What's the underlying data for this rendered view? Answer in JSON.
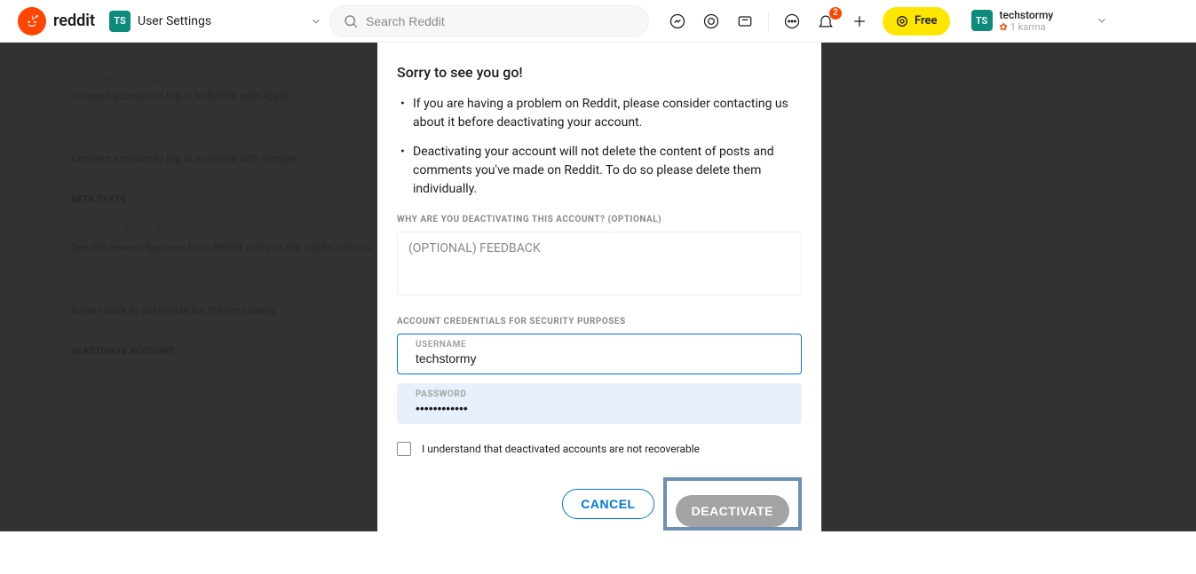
{
  "header": {
    "brand": "reddit",
    "avatar_initials": "TS",
    "community_label": "User Settings",
    "search_placeholder": "Search Reddit",
    "notification_count": "2",
    "free_label": "Free",
    "username": "techstormy",
    "karma_line": "1 karma"
  },
  "settings": {
    "apple_title": "Connect to Apple",
    "apple_desc": "Connect account to log in to Reddit with Apple",
    "google_title": "Connect to Google",
    "google_desc": "Connect account to log in to Reddit with Google",
    "beta_section": "BETA TESTS",
    "beta_opt_title": "Opt into beta tests",
    "beta_opt_desc": "See the newest features from Reddit and join the r/beta commu",
    "redesign_title": "Opt out of the redesign",
    "redesign_desc": "Revert back to old Reddit for the time being",
    "deactivate_section": "DEACTIVATE ACCOUNT"
  },
  "modal": {
    "title": "Sorry to see you go!",
    "bullet1": "If you are having a problem on Reddit, please consider contacting us about it before deactivating your account.",
    "bullet2": "Deactivating your account will not delete the content of posts and comments you've made on Reddit. To do so please delete them individually.",
    "why_label": "WHY ARE YOU DEACTIVATING THIS ACCOUNT? (OPTIONAL)",
    "feedback_placeholder": "(OPTIONAL) FEEDBACK",
    "credentials_label": "ACCOUNT CREDENTIALS FOR SECURITY PURPOSES",
    "username_label": "USERNAME",
    "username_value": "techstormy",
    "password_label": "PASSWORD",
    "password_value": "••••••••••••",
    "checkbox_label": "I understand that deactivated accounts are not recoverable",
    "cancel": "CANCEL",
    "deactivate": "DEACTIVATE"
  }
}
